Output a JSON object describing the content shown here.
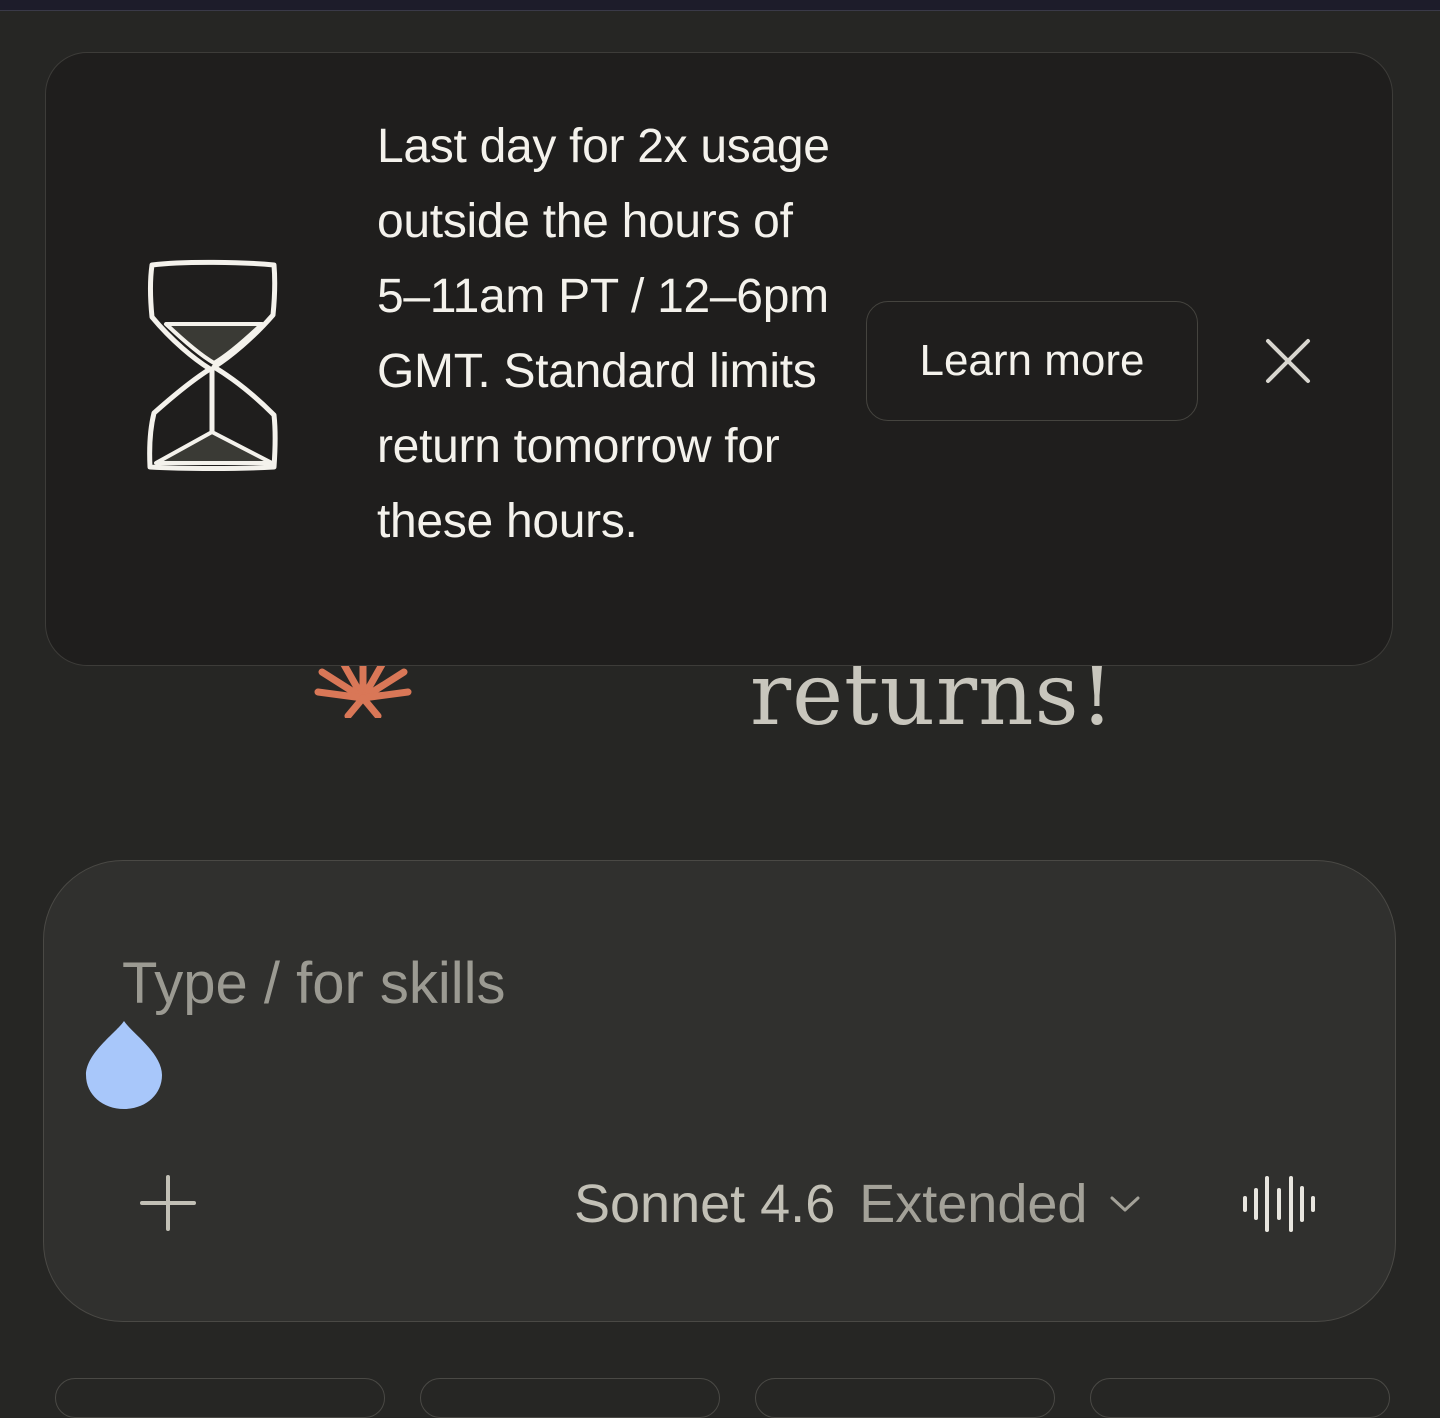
{
  "banner": {
    "message": "Last day for 2x usage outside the hours of 5–11am PT / 12–6pm GMT. Standard limits return tomorrow for these hours.",
    "learn_more_label": "Learn more",
    "icon": "hourglass-icon",
    "close_icon": "close-icon"
  },
  "greeting": {
    "visible_text": "returns!"
  },
  "composer": {
    "placeholder": "Type / for skills",
    "value": "",
    "add_icon": "plus-icon",
    "model_name": "Sonnet 4.6",
    "model_mode": "Extended",
    "chevron_icon": "chevron-down-icon",
    "voice_icon": "voice-waveform-icon"
  },
  "colors": {
    "background": "#262624",
    "banner_bg": "#1f1e1d",
    "composer_bg": "#30302e",
    "accent": "#d97757",
    "cursor_handle": "#a8c7fa"
  }
}
